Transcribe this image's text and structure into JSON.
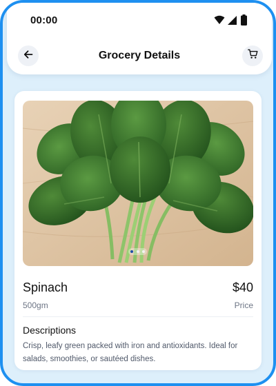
{
  "status_bar": {
    "time": "00:00",
    "icons": [
      "wifi-icon",
      "signal-icon",
      "battery-icon"
    ]
  },
  "header": {
    "title": "Grocery Details",
    "back_icon": "arrow-left-icon",
    "cart_icon": "cart-icon"
  },
  "product": {
    "name": "Spinach",
    "price": "$40",
    "weight": "500gm",
    "price_caption": "Price",
    "image_slides": 3,
    "active_slide": 1,
    "description_heading": "Descriptions",
    "description": "Crisp, leafy green packed with iron and antioxidants. Ideal for salads, smoothies, or sautéed dishes."
  },
  "colors": {
    "frame_border": "#1e90f0",
    "background": "#ddeffb",
    "card": "#ffffff",
    "icon_button_bg": "#eef1f6",
    "text_primary": "#111111",
    "text_secondary": "#6d7585",
    "active_dot": "#1e4fa8"
  }
}
